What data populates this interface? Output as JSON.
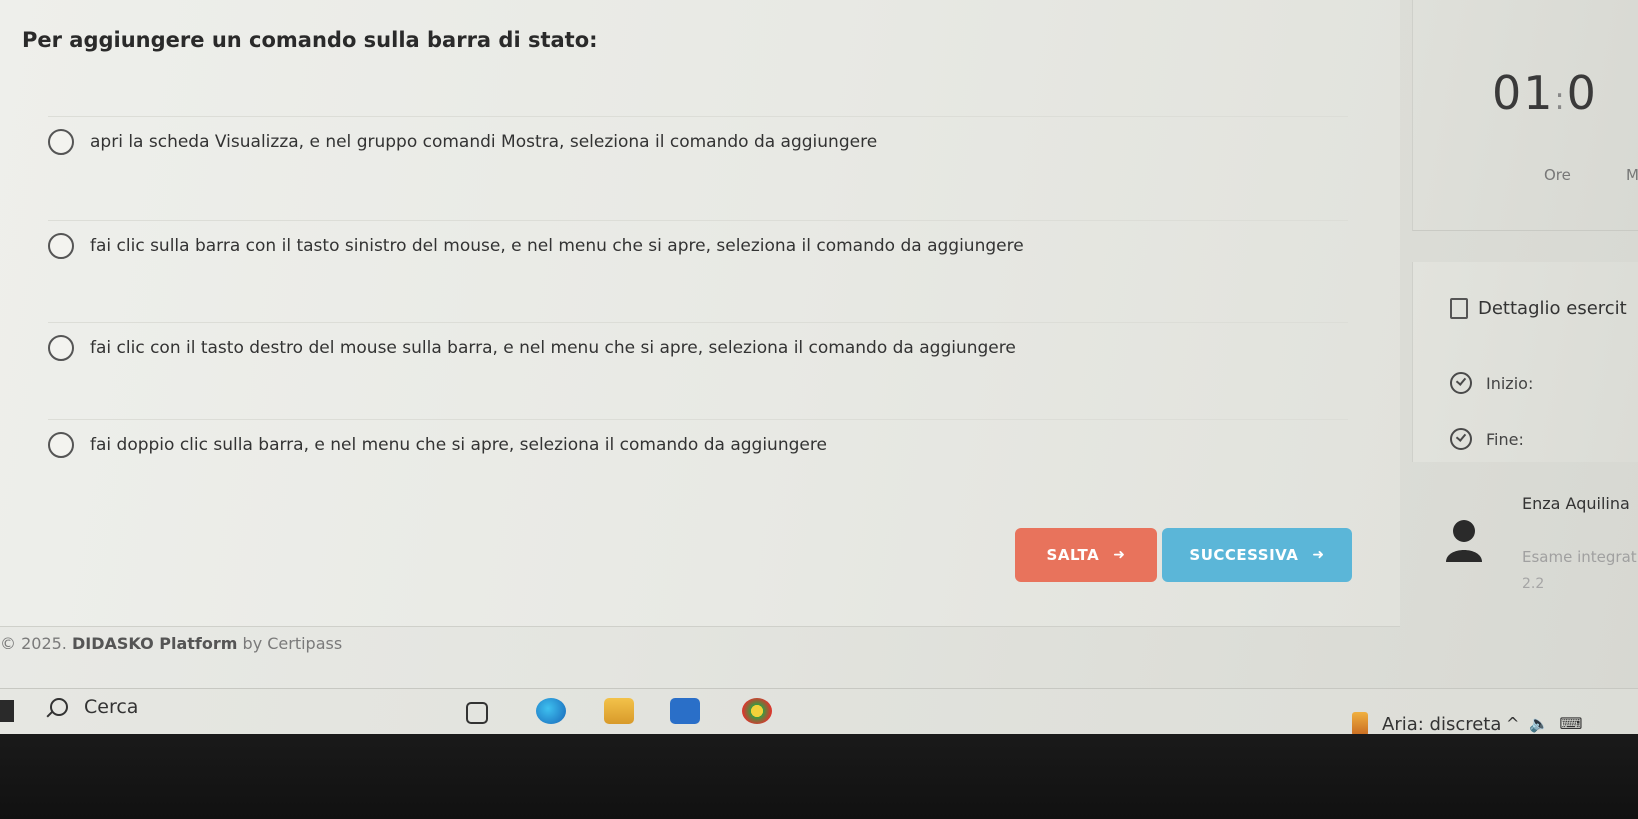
{
  "quiz": {
    "question": "Per aggiungere un comando sulla barra di stato:",
    "options": [
      {
        "label": "apri la scheda Visualizza, e nel gruppo comandi Mostra, seleziona il comando da aggiungere"
      },
      {
        "label": "fai clic sulla barra con il tasto sinistro del mouse, e nel menu che si apre, seleziona il comando da aggiungere"
      },
      {
        "label": "fai clic con il tasto destro del mouse sulla barra, e nel menu che si apre, seleziona il comando da aggiungere"
      },
      {
        "label": "fai doppio clic sulla barra, e nel menu che si apre, seleziona il comando da aggiungere"
      }
    ],
    "skip_label": "SALTA",
    "next_label": "SUCCESSIVA"
  },
  "footer": {
    "copyright": "© 2025.",
    "brand": "DIDASKO Platform",
    "by": "by Certipass"
  },
  "timer": {
    "value": "01",
    "sep": ":",
    "next": "0",
    "label_hours": "Ore",
    "label_minutes": "M"
  },
  "details": {
    "title": "Dettaglio esercit",
    "start_label": "Inizio:",
    "end_label": "Fine:"
  },
  "user": {
    "name": "Enza Aquilina",
    "subtitle": "Esame integrat",
    "extra": "2.2"
  },
  "taskbar": {
    "search_label": "Cerca",
    "weather": "Aria: discreta"
  }
}
